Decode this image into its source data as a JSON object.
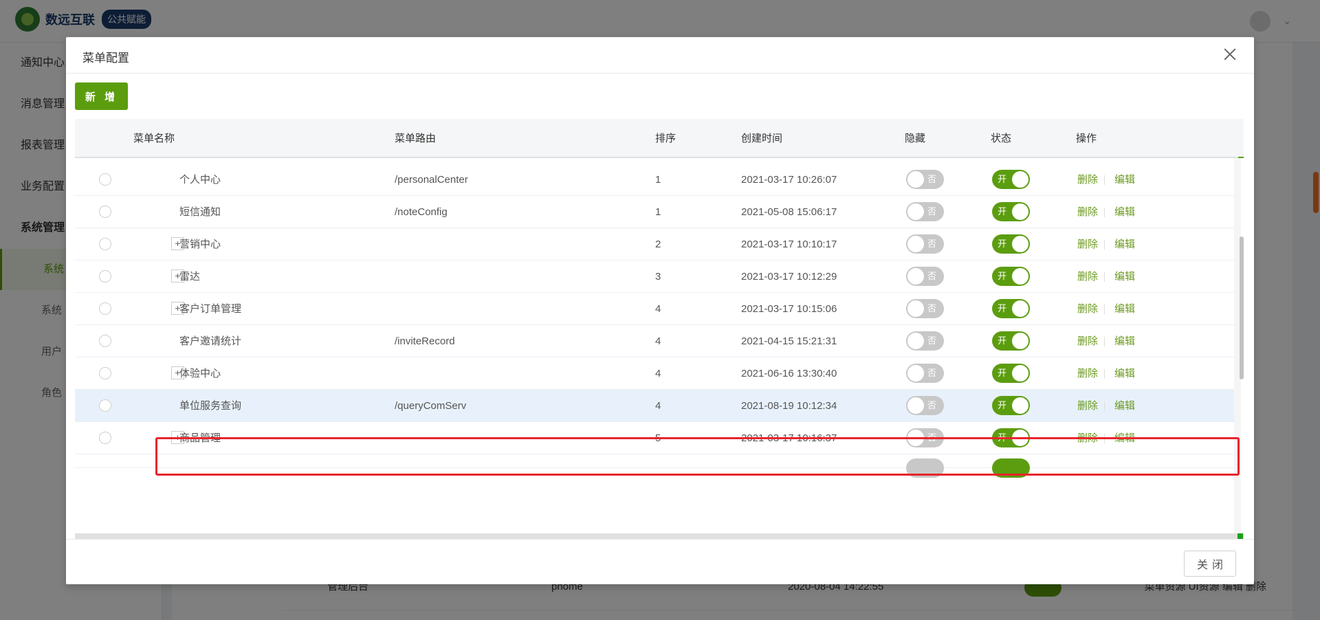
{
  "app": {
    "logo_text": "数远互联",
    "logo_badge": "公共赋能"
  },
  "sidebar": {
    "items": [
      {
        "label": "通知中心"
      },
      {
        "label": "消息管理"
      },
      {
        "label": "报表管理"
      },
      {
        "label": "业务配置"
      },
      {
        "label": "系统管理"
      }
    ],
    "sub_items": [
      {
        "label": "系统"
      },
      {
        "label": "系统"
      },
      {
        "label": "用户"
      },
      {
        "label": "角色"
      }
    ]
  },
  "background_table": {
    "row": {
      "name": "管理后台",
      "code": "phome",
      "time": "2020-08-04 14:22:55",
      "links": "菜单资源  UI资源  编辑  删除"
    }
  },
  "modal": {
    "title": "菜单配置",
    "add_label": "新 增",
    "close_label": "关闭",
    "columns": [
      "菜单名称",
      "菜单路由",
      "排序",
      "创建时间",
      "隐藏",
      "状态",
      "操作"
    ],
    "switch_off_text": "否",
    "switch_on_text": "开",
    "delete_label": "删除",
    "edit_label": "编辑",
    "rows": [
      {
        "name": "个人中心",
        "route": "/personalCenter",
        "sort": "1",
        "created": "2021-03-17 10:26:07",
        "expandable": false,
        "hidden": false,
        "enabled": true
      },
      {
        "name": "短信通知",
        "route": "/noteConfig",
        "sort": "1",
        "created": "2021-05-08 15:06:17",
        "expandable": false,
        "hidden": false,
        "enabled": true
      },
      {
        "name": "营销中心",
        "route": "",
        "sort": "2",
        "created": "2021-03-17 10:10:17",
        "expandable": true,
        "expand_symbol": "+",
        "hidden": false,
        "enabled": true
      },
      {
        "name": "雷达",
        "route": "",
        "sort": "3",
        "created": "2021-03-17 10:12:29",
        "expandable": true,
        "expand_symbol": "+",
        "hidden": false,
        "enabled": true
      },
      {
        "name": "客户订单管理",
        "route": "",
        "sort": "4",
        "created": "2021-03-17 10:15:06",
        "expandable": true,
        "expand_symbol": "+",
        "hidden": false,
        "enabled": true
      },
      {
        "name": "客户邀请统计",
        "route": "/inviteRecord",
        "sort": "4",
        "created": "2021-04-15 15:21:31",
        "expandable": false,
        "hidden": false,
        "enabled": true
      },
      {
        "name": "体验中心",
        "route": "",
        "sort": "4",
        "created": "2021-06-16 13:30:40",
        "expandable": true,
        "expand_symbol": "+",
        "hidden": false,
        "enabled": true
      },
      {
        "name": "单位服务查询",
        "route": "/queryComServ",
        "sort": "4",
        "created": "2021-08-19 10:12:34",
        "expandable": false,
        "hidden": false,
        "enabled": true,
        "selected": true
      },
      {
        "name": "商品管理",
        "route": "",
        "sort": "5",
        "created": "2021-03-17 10:16:37",
        "expandable": true,
        "expand_symbol": "+",
        "hidden": false,
        "enabled": true
      }
    ]
  },
  "colors": {
    "accent": "#5c9d0f",
    "highlight_border": "#e8242b",
    "selected_row": "#e8f1fb"
  }
}
